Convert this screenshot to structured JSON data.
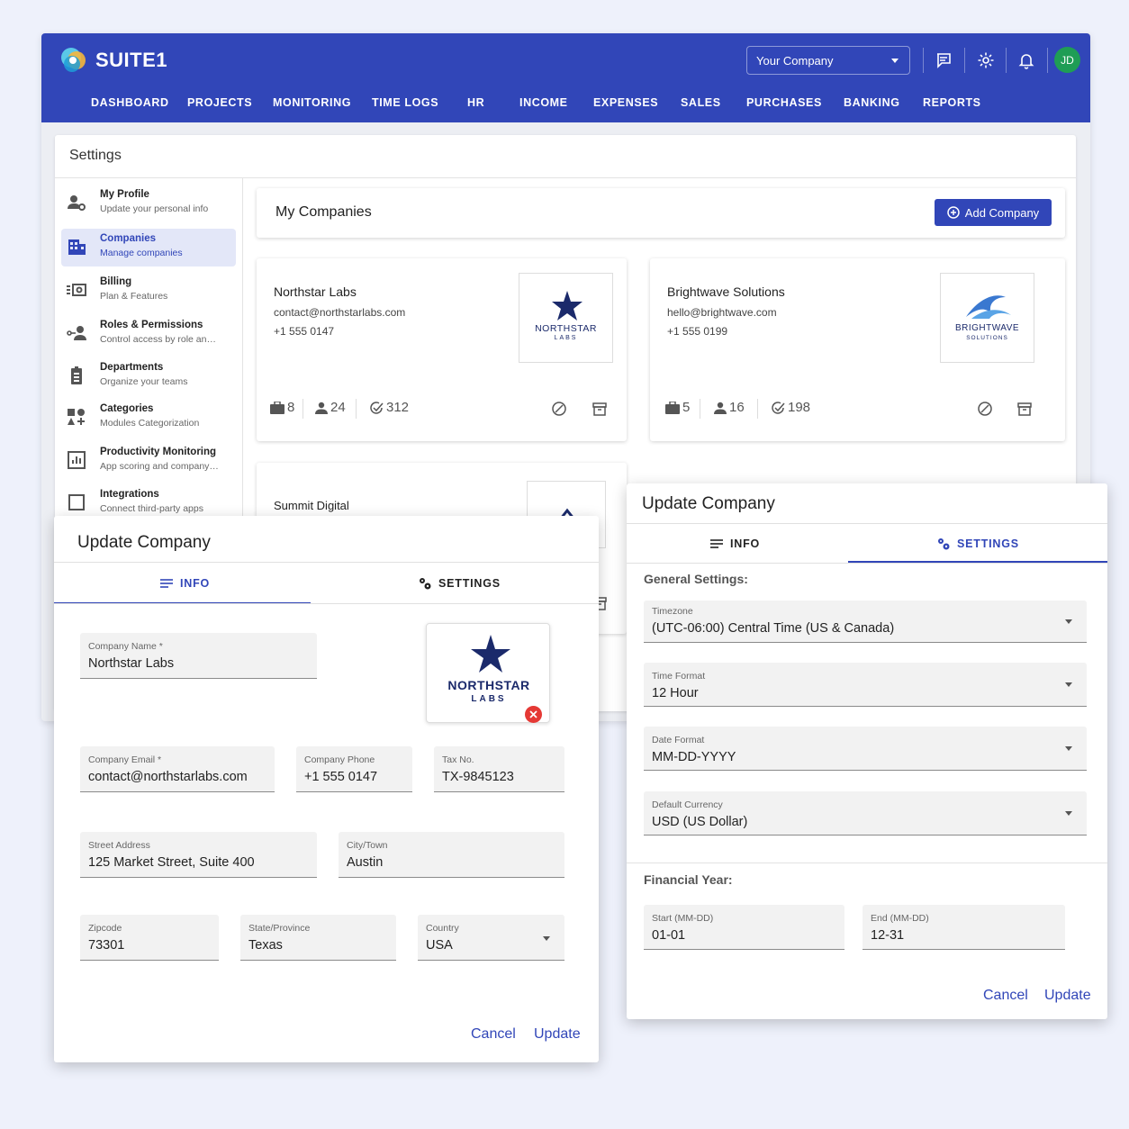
{
  "app": {
    "name": "SUITE1",
    "company_select": "Your Company",
    "avatar_initials": "JD",
    "nav": [
      "DASHBOARD",
      "PROJECTS",
      "MONITORING",
      "TIME LOGS",
      "HR",
      "INCOME",
      "EXPENSES",
      "SALES",
      "PURCHASES",
      "BANKING",
      "REPORTS"
    ]
  },
  "settings": {
    "title": "Settings",
    "sidebar": [
      {
        "title": "My Profile",
        "subtitle": "Update your personal info",
        "icon": "user-gear-icon"
      },
      {
        "title": "Companies",
        "subtitle": "Manage companies",
        "icon": "building-icon",
        "active": true
      },
      {
        "title": "Billing",
        "subtitle": "Plan & Features",
        "icon": "billing-icon"
      },
      {
        "title": "Roles & Permissions",
        "subtitle": "Control access by role an…",
        "icon": "roles-icon"
      },
      {
        "title": "Departments",
        "subtitle": "Organize your teams",
        "icon": "badge-icon"
      },
      {
        "title": "Categories",
        "subtitle": "Modules Categorization",
        "icon": "categories-icon"
      },
      {
        "title": "Productivity Monitoring",
        "subtitle": "App scoring and company…",
        "icon": "chart-icon"
      },
      {
        "title": "Integrations",
        "subtitle": "Connect third-party apps",
        "icon": "square-icon"
      }
    ]
  },
  "companies": {
    "header": "My Companies",
    "add_button": "Add Company",
    "cards": [
      {
        "name": "Northstar Labs",
        "email": "contact@northstarlabs.com",
        "phone": "+1 555 0147",
        "logo_text": "NORTHSTAR",
        "logo_sub": "LABS",
        "projects": "8",
        "users": "24",
        "tasks": "312"
      },
      {
        "name": "Brightwave Solutions",
        "email": "hello@brightwave.com",
        "phone": "+1 555 0199",
        "logo_text": "BRIGHTWAVE",
        "logo_sub": "SOLUTIONS",
        "projects": "5",
        "users": "16",
        "tasks": "198"
      },
      {
        "name": "Summit Digital"
      }
    ]
  },
  "update_info": {
    "title": "Update Company",
    "tabs": {
      "info": "INFO",
      "settings": "SETTINGS"
    },
    "logo_text": "NORTHSTAR",
    "logo_sub": "LABS",
    "fields": {
      "company_name": {
        "label": "Company Name *",
        "value": "Northstar Labs"
      },
      "company_email": {
        "label": "Company Email *",
        "value": "contact@northstarlabs.com"
      },
      "company_phone": {
        "label": "Company Phone",
        "value": "+1 555 0147"
      },
      "tax_no": {
        "label": "Tax No.",
        "value": "TX-9845123"
      },
      "street": {
        "label": "Street Address",
        "value": "125 Market Street, Suite 400"
      },
      "city": {
        "label": "City/Town",
        "value": "Austin"
      },
      "zipcode": {
        "label": "Zipcode",
        "value": "73301"
      },
      "state": {
        "label": "State/Province",
        "value": "Texas"
      },
      "country": {
        "label": "Country",
        "value": "USA"
      }
    },
    "cancel": "Cancel",
    "update": "Update"
  },
  "update_settings": {
    "title": "Update Company",
    "tabs": {
      "info": "INFO",
      "settings": "SETTINGS"
    },
    "general_label": "General Settings:",
    "timezone": {
      "label": "Timezone",
      "value": "(UTC-06:00) Central Time (US & Canada)"
    },
    "time_format": {
      "label": "Time Format",
      "value": "12 Hour"
    },
    "date_format": {
      "label": "Date Format",
      "value": "MM-DD-YYYY"
    },
    "currency": {
      "label": "Default Currency",
      "value": "USD (US Dollar)"
    },
    "financial_label": "Financial Year:",
    "fy_start": {
      "label": "Start (MM-DD)",
      "value": "01-01"
    },
    "fy_end": {
      "label": "End (MM-DD)",
      "value": "12-31"
    },
    "cancel": "Cancel",
    "update": "Update"
  },
  "colors": {
    "primary": "#3146b8",
    "navy": "#1b2a6b",
    "wave": "#3a78d0",
    "avatar": "#1f9d55",
    "danger": "#e53935"
  }
}
